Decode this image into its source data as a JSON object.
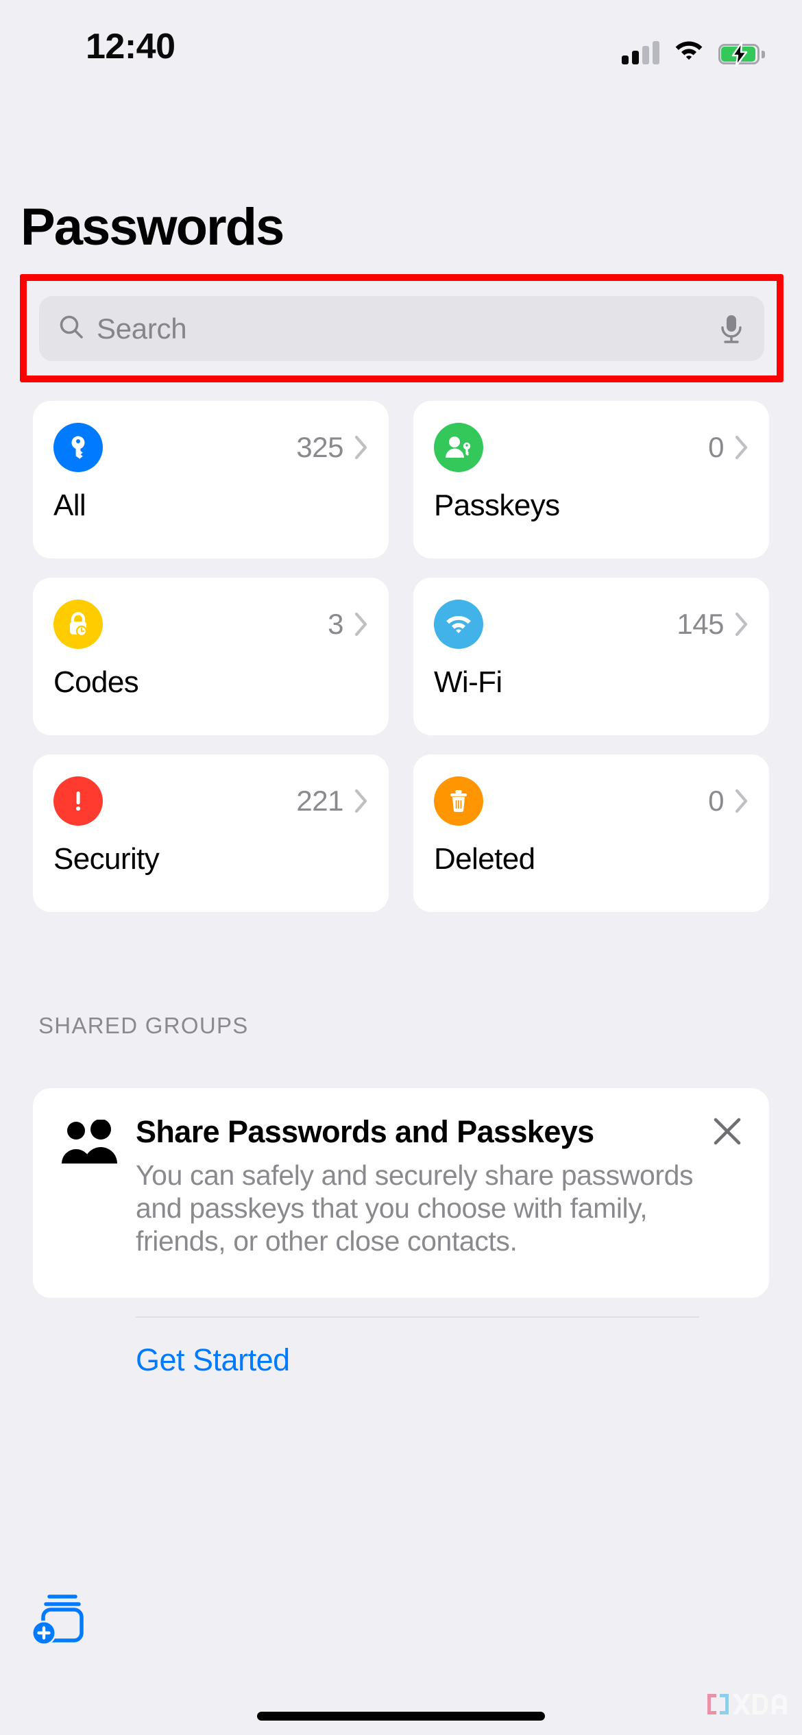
{
  "status_bar": {
    "time": "12:40",
    "cellular_icon": "cellular-signal-icon",
    "cellular_bars_filled": 2,
    "cellular_bars_total": 4,
    "wifi_icon": "wifi-icon",
    "battery_icon": "battery-charging-icon",
    "battery_color": "#34C759",
    "battery_charging": true
  },
  "header": {
    "title": "Passwords"
  },
  "search": {
    "placeholder": "Search",
    "value": "",
    "search_icon": "search-icon",
    "mic_icon": "microphone-icon",
    "highlight_color": "#FF0000",
    "highlighted": true
  },
  "categories": [
    {
      "label": "All",
      "count": "325",
      "icon": "key-icon",
      "color": "#007AFF",
      "chevron": "chevron-right-icon"
    },
    {
      "label": "Passkeys",
      "count": "0",
      "icon": "person-key-icon",
      "color": "#34C759",
      "chevron": "chevron-right-icon"
    },
    {
      "label": "Codes",
      "count": "3",
      "icon": "lock-clock-icon",
      "color": "#FFCC00",
      "chevron": "chevron-right-icon"
    },
    {
      "label": "Wi-Fi",
      "count": "145",
      "icon": "wifi-icon",
      "color": "#41B3E8",
      "chevron": "chevron-right-icon"
    },
    {
      "label": "Security",
      "count": "221",
      "icon": "exclamation-icon",
      "color": "#FF3B30",
      "chevron": "chevron-right-icon"
    },
    {
      "label": "Deleted",
      "count": "0",
      "icon": "trash-icon",
      "color": "#FF9500",
      "chevron": "chevron-right-icon"
    }
  ],
  "shared_groups": {
    "section_label": "SHARED GROUPS",
    "card": {
      "title": "Share Passwords and Passkeys",
      "description": "You can safely and securely share passwords and passkeys that you choose with family, friends, or other close contacts.",
      "cta_label": "Get Started",
      "cta_color": "#007AFF",
      "people_icon": "two-people-icon",
      "close_icon": "close-icon"
    }
  },
  "toolbar": {
    "add_password_icon": "add-password-icon",
    "add_password_color": "#007AFF"
  },
  "watermark": {
    "text": "XDA"
  }
}
